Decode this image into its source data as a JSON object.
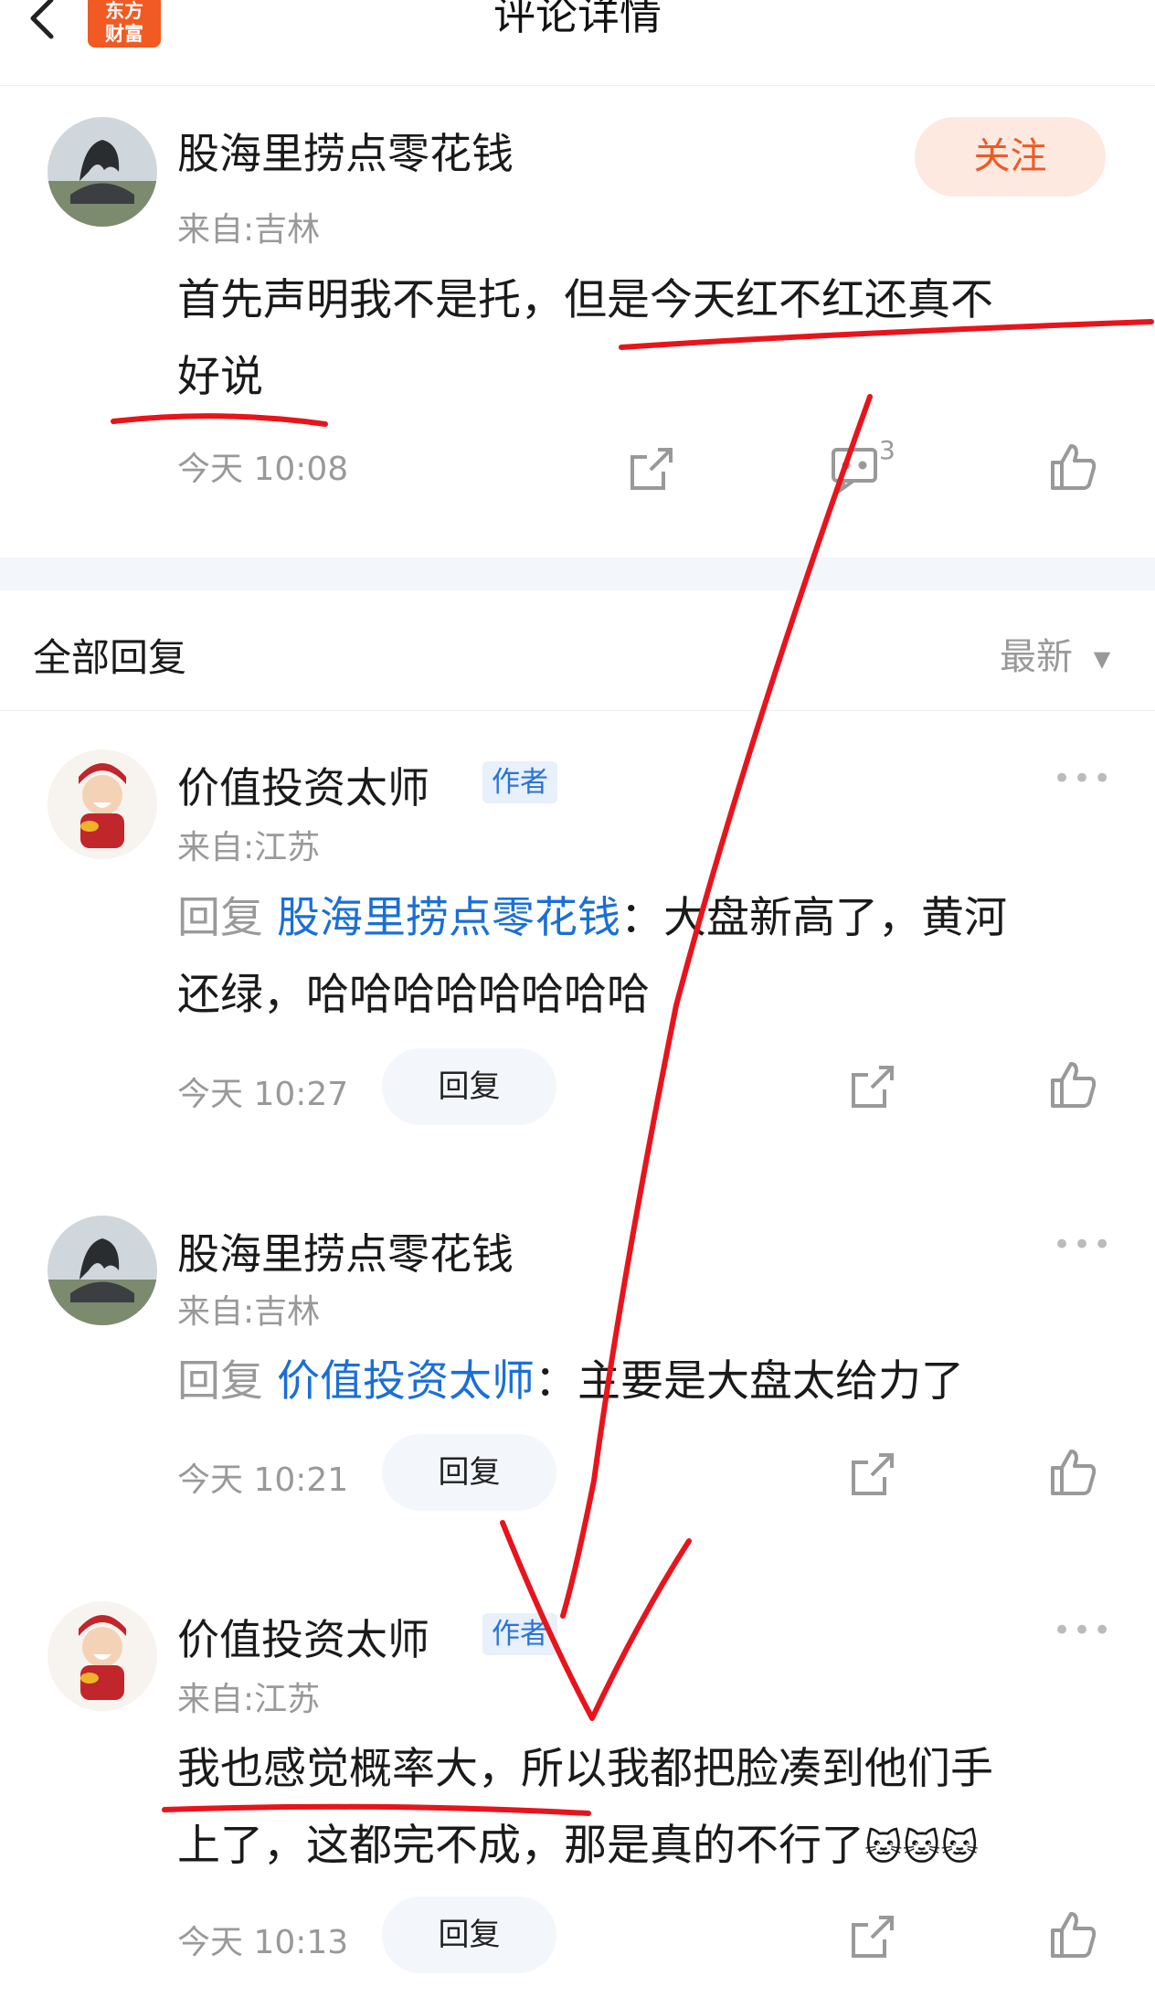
{
  "header": {
    "title": "评论详情",
    "logo_line1": "东方",
    "logo_line2": "财富"
  },
  "main_comment": {
    "user": "股海里捞点零花钱",
    "location": "来自:吉林",
    "follow_label": "关注",
    "text_line1": "首先声明我不是托，但是今天红不红还真不",
    "text_line2": "好说",
    "time": "今天 10:08",
    "comment_count": "3"
  },
  "replies_header": {
    "title": "全部回复",
    "sort_label": "最新"
  },
  "replies": [
    {
      "user": "价值投资太师",
      "badge": "作者",
      "location": "来自:江苏",
      "reply_prefix": "回复",
      "reply_to": "股海里捞点零花钱",
      "text_line1": "：大盘新高了，黄河",
      "text_line2": "还绿，哈哈哈哈哈哈哈哈",
      "time": "今天 10:27",
      "reply_label": "回复"
    },
    {
      "user": "股海里捞点零花钱",
      "location": "来自:吉林",
      "reply_prefix": "回复",
      "reply_to": "价值投资太师",
      "text_line1": "：主要是大盘太给力了",
      "time": "今天 10:21",
      "reply_label": "回复"
    },
    {
      "user": "价值投资太师",
      "badge": "作者",
      "location": "来自:江苏",
      "text_line1": "我也感觉概率大，所以我都把脸凑到他们手",
      "text_line2": "上了，这都完不成，那是真的不行了",
      "time": "今天 10:13",
      "reply_label": "回复"
    }
  ],
  "colors": {
    "accent_orange": "#ee5a24",
    "link_blue": "#1a6fd6",
    "annotation_red": "#e8141c"
  }
}
